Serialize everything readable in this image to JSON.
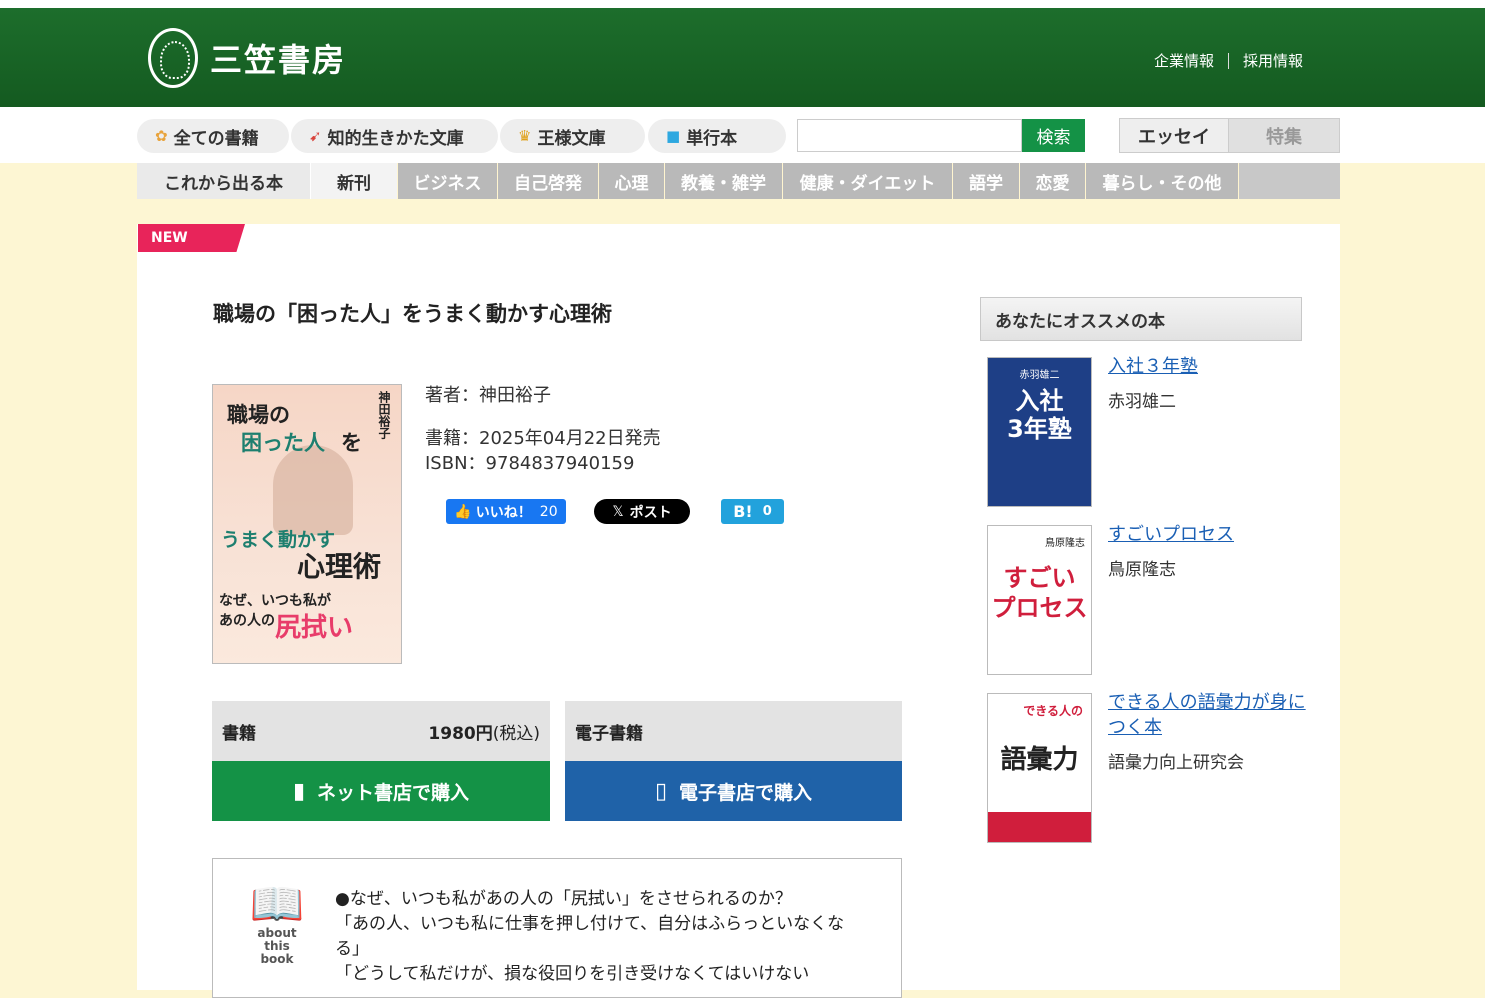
{
  "header": {
    "logo_text": "三笠書房",
    "links": [
      "企業情報",
      "採用情報"
    ]
  },
  "nav": {
    "pills": [
      "全ての書籍",
      "知的生きかた文庫",
      "王様文庫",
      "単行本"
    ],
    "search_button": "検索",
    "search_placeholder": "",
    "tabs": [
      "エッセイ",
      "特集"
    ]
  },
  "categories": [
    "これから出る本",
    "新刊",
    "ビジネス",
    "自己啓発",
    "心理",
    "教養・雑学",
    "健康・ダイエット",
    "語学",
    "恋愛",
    "暮らし・その他"
  ],
  "badge": "NEW",
  "book": {
    "title": "職場の「困った人」をうまく動かす心理術",
    "author": "著者：神田裕子",
    "release": "書籍：2025年04月22日発売",
    "isbn": "ISBN：9784837940159",
    "cover": {
      "line1": "職場の",
      "line2": "困った人",
      "line2b": "を",
      "line3": "うまく動かす",
      "line4": "心理術",
      "line5a": "なぜ、いつも私が",
      "line5b": "あの人の",
      "line6": "尻拭い",
      "author": "神田裕子"
    }
  },
  "share": {
    "like_label": "いいね！",
    "like_count": "20",
    "post_label": "ポスト",
    "hatena_label": "B!",
    "hatena_count": "0"
  },
  "purchase": {
    "paper_label": "書籍",
    "price": "1980円",
    "tax": "(税込)",
    "ebook_label": "電子書籍",
    "paper_button": "ネット書店で購入",
    "ebook_button": "電子書店で購入"
  },
  "about": {
    "caption1": "about this",
    "caption2": "book",
    "text": "●なぜ、いつも私があの人の「尻拭い」をさせられるのか？\n「あの人、いつも私に仕事を押し付けて、自分はふらっといなくなる」\n「どうして私だけが、損な役回りを引き受けなくてはいけない"
  },
  "recommend": {
    "heading": "あなたにオススメの本",
    "items": [
      {
        "title": "入社３年塾",
        "author": "赤羽雄二",
        "cover_text": "入社\n3年塾",
        "cover_sub": "赤羽雄二"
      },
      {
        "title": "すごいプロセス",
        "author": "鳥原隆志",
        "cover_text": "すごい\nプロセス",
        "cover_sub": "鳥原隆志"
      },
      {
        "title": "できる人の語彙力が身につく本",
        "author": "語彙力向上研究会",
        "cover_text": "語彙力",
        "cover_sub": "できる人の"
      }
    ]
  },
  "colors": {
    "header_green": "#1d6e2c",
    "buy_green": "#149246",
    "buy_blue": "#1f62a8",
    "new_red": "#e8245a",
    "background_cream": "#fdf6d3"
  }
}
